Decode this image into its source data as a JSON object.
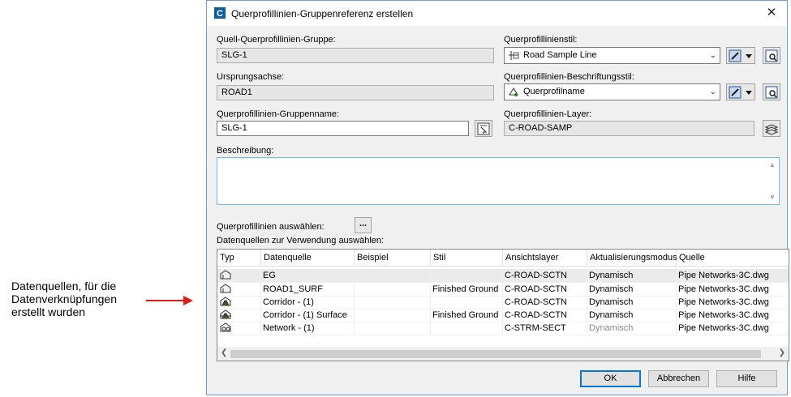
{
  "annotation": {
    "line1": "Datenquellen, für die",
    "line2": "Datenverknüpfungen",
    "line3": "erstellt wurden"
  },
  "dialog": {
    "title": "Querprofillinien-Gruppenreferenz erstellen",
    "close_glyph": "✕"
  },
  "fields": {
    "source_group_label": "Quell-Querprofillinien-Gruppe:",
    "source_group_value": "SLG-1",
    "origin_axis_label": "Ursprungsachse:",
    "origin_axis_value": "ROAD1",
    "group_name_label": "Querprofillinien-Gruppenname:",
    "group_name_value": "SLG-1",
    "style_label": "Querprofillinienstil:",
    "style_value": "Road Sample Line",
    "label_style_label": "Querprofillinien-Beschriftungsstil:",
    "label_style_value": "Querprofilname",
    "layer_label": "Querprofillinien-Layer:",
    "layer_value": "C-ROAD-SAMP",
    "description_label": "Beschreibung:",
    "description_value": "",
    "select_label": "Querprofillinien auswählen:",
    "select_button": "...",
    "datasources_label": "Datenquellen zur Verwendung auswählen:"
  },
  "table": {
    "columns": [
      "Typ",
      "Datenquelle",
      "Beispiel",
      "Stil",
      "Ansichtslayer",
      "Aktualisierungsmodus",
      "Quelle"
    ],
    "rows": [
      {
        "type_icon": "surface-icon",
        "source": "EG",
        "sample": true,
        "style": "",
        "layer": "C-ROAD-SCTN",
        "mode": "Dynamisch",
        "mode_gray": false,
        "file": "Pipe Networks-3C.dwg"
      },
      {
        "type_icon": "surface-icon",
        "source": "ROAD1_SURF",
        "sample": true,
        "style": "Finished Ground",
        "layer": "C-ROAD-SCTN",
        "mode": "Dynamisch",
        "mode_gray": false,
        "file": "Pipe Networks-3C.dwg"
      },
      {
        "type_icon": "corridor-icon",
        "source": "Corridor - (1)",
        "sample": true,
        "style": "",
        "layer": "C-ROAD-SCTN",
        "mode": "Dynamisch",
        "mode_gray": false,
        "file": "Pipe Networks-3C.dwg"
      },
      {
        "type_icon": "corridor-surface-icon",
        "source": "Corridor - (1) Surface",
        "sample": true,
        "style": "Finished Ground",
        "layer": "C-ROAD-SCTN",
        "mode": "Dynamisch",
        "mode_gray": false,
        "file": "Pipe Networks-3C.dwg"
      },
      {
        "type_icon": "pipe-network-icon",
        "source": "Network - (1)",
        "sample": true,
        "style": "",
        "layer": "C-STRM-SECT",
        "mode": "Dynamisch",
        "mode_gray": true,
        "file": "Pipe Networks-3C.dwg"
      }
    ]
  },
  "buttons": {
    "ok": "OK",
    "cancel": "Abbrechen",
    "help": "Hilfe"
  },
  "colors": {
    "accent": "#0078d7",
    "arrow": "#e01b1b",
    "check": "#2e7d32"
  }
}
